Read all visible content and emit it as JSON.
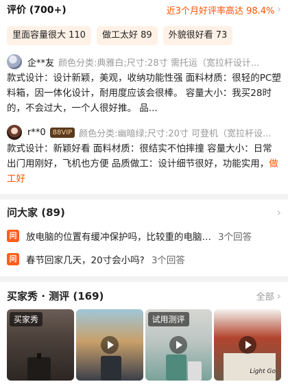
{
  "reviews": {
    "title": "评价 (700+)",
    "good_rate": "近3个月好评率高达 98.4%",
    "tags": [
      {
        "label": "里面容量很大 110"
      },
      {
        "label": "做工太好 89"
      },
      {
        "label": "外貌很好看 73"
      }
    ],
    "items": [
      {
        "name": "企**友",
        "vip": "",
        "spec": "颜色分类:典雅白;尺寸:28寸 需托运（宽拉杆设计...",
        "body": "款式设计：设计新颖，美观，收纳功能性强 面料材质：很轻的PC塑料箱，因一体化设计，耐用度应该会很棒。 容量大小：我买28时的，不会过大，一个人很好推。 品...",
        "highlight": ""
      },
      {
        "name": "r**0",
        "vip": "88VIP",
        "spec": "颜色分类:幽暗绿;尺寸:20寸 可登机（宽拉杆设...",
        "body": "款式设计：新颖好看 面料材质：很结实不怕摔撞 容量大小：日常出门用刚好，飞机也方便 品质做工：设计细节很好，功能实用，",
        "highlight": "做工好"
      }
    ]
  },
  "qa": {
    "title": "问大家 (89)",
    "badge": "问",
    "items": [
      {
        "question": "放电脑的位置有缓冲保护吗，比较重的电脑比...",
        "answers": "3个回答"
      },
      {
        "question": "春节回家几天，20寸会小吗?",
        "answers": "3个回答"
      }
    ]
  },
  "show": {
    "title": "买家秀 · 测评 (169)",
    "all_label": "全部",
    "thumbs": [
      {
        "label": "买家秀",
        "video": false,
        "icon": "suitcase-photo"
      },
      {
        "label": "",
        "video": true,
        "icon": "suitcase-photo"
      },
      {
        "label": "试用测评",
        "video": true,
        "icon": "suitcase-photo"
      },
      {
        "label": "",
        "video": true,
        "icon": "suitcase-box-photo",
        "box_text": "Light Go"
      }
    ]
  },
  "colors": {
    "accent": "#ff5000",
    "tag_bg": "#fff1e6",
    "badge": "#ff5e1a"
  }
}
